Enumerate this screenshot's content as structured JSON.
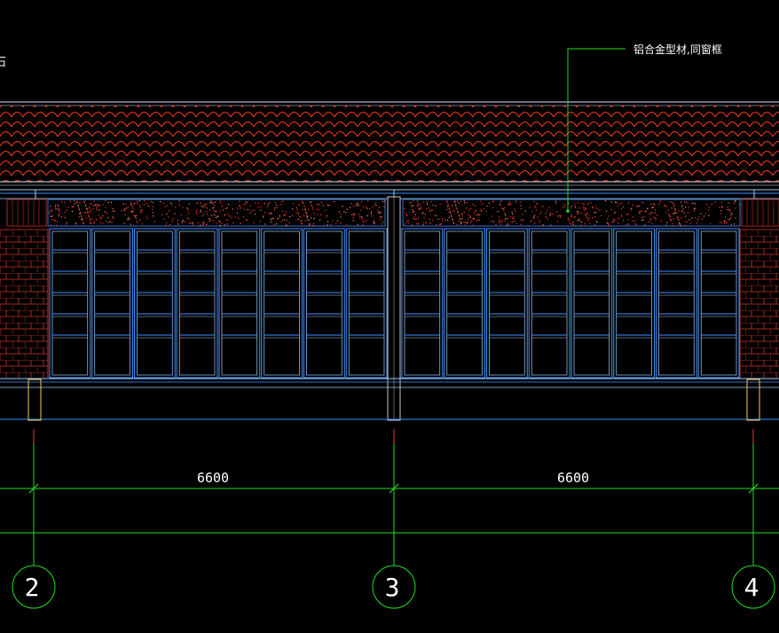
{
  "annotation": {
    "leader_label": "铝合金型材,同窗框",
    "corner_fragment": "石"
  },
  "dimensions": [
    {
      "value": "6600"
    },
    {
      "value": "6600"
    }
  ],
  "axes": [
    {
      "label": "2"
    },
    {
      "label": "3"
    },
    {
      "label": "4"
    }
  ],
  "colors": {
    "background": "#000000",
    "tile": "#ff3b1e",
    "tile_band_edge": "#dde6ff",
    "glazing": "#3f8fff",
    "glazing_light": "#9fd0ff",
    "wall": "#cc3322",
    "dimension": "#22dd22",
    "axis_tick": "#ff3333",
    "text": "#ffffff",
    "column_fill": "#c8c8c8"
  }
}
